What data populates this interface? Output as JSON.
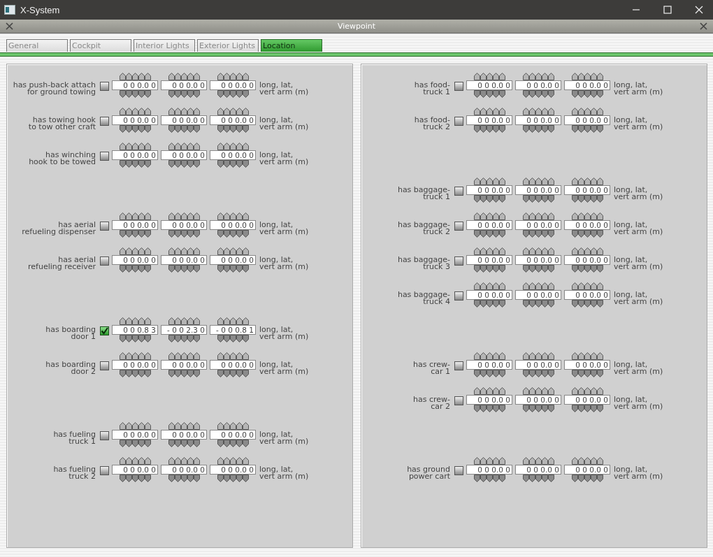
{
  "window": {
    "title": "X-System"
  },
  "dialog": {
    "title": "Viewpoint"
  },
  "tabs": [
    {
      "label": "General",
      "selected": false
    },
    {
      "label": "Cockpit",
      "selected": false
    },
    {
      "label": "Interior Lights",
      "selected": false
    },
    {
      "label": "Exterior Lights",
      "selected": false
    },
    {
      "label": "Location",
      "selected": true
    }
  ],
  "panels": [
    {
      "groups": [
        {
          "rows": [
            {
              "label": "has push-back attach\nfor ground towing",
              "checked": false,
              "values": [
                "0 0 0.0 0",
                "0 0 0.0 0",
                "0 0 0.0 0"
              ],
              "units": "long, lat,\nvert arm (m)"
            },
            {
              "label": "has towing hook\nto tow other craft",
              "checked": false,
              "values": [
                "0 0 0.0 0",
                "0 0 0.0 0",
                "0 0 0.0 0"
              ],
              "units": "long, lat,\nvert arm (m)"
            },
            {
              "label": "has winching\nhook to be towed",
              "checked": false,
              "values": [
                "0 0 0.0 0",
                "0 0 0.0 0",
                "0 0 0.0 0"
              ],
              "units": "long, lat,\nvert arm (m)"
            }
          ]
        },
        {
          "rows": [
            {
              "label": "has aerial\nrefueling dispenser",
              "checked": false,
              "values": [
                "0 0 0.0 0",
                "0 0 0.0 0",
                "0 0 0.0 0"
              ],
              "units": "long, lat,\nvert arm (m)"
            },
            {
              "label": "has aerial\nrefueling receiver",
              "checked": false,
              "values": [
                "0 0 0.0 0",
                "0 0 0.0 0",
                "0 0 0.0 0"
              ],
              "units": "long, lat,\nvert arm (m)"
            }
          ]
        },
        {
          "rows": [
            {
              "label": "has boarding\ndoor 1",
              "checked": true,
              "values": [
                "0 0 0.8 3",
                "- 0 0 2.3 0",
                "- 0 0 0.8 1"
              ],
              "units": "long, lat,\nvert arm (m)"
            },
            {
              "label": "has boarding\ndoor 2",
              "checked": false,
              "values": [
                "0 0 0.0 0",
                "0 0 0.0 0",
                "0 0 0.0 0"
              ],
              "units": "long, lat,\nvert arm (m)"
            }
          ]
        },
        {
          "rows": [
            {
              "label": "has fueling\ntruck 1",
              "checked": false,
              "values": [
                "0 0 0.0 0",
                "0 0 0.0 0",
                "0 0 0.0 0"
              ],
              "units": "long, lat,\nvert arm (m)"
            },
            {
              "label": "has fueling\ntruck 2",
              "checked": false,
              "values": [
                "0 0 0.0 0",
                "0 0 0.0 0",
                "0 0 0.0 0"
              ],
              "units": "long, lat,\nvert arm (m)"
            }
          ]
        }
      ]
    },
    {
      "groups": [
        {
          "rows": [
            {
              "label": "has food-\ntruck 1",
              "checked": false,
              "values": [
                "0 0 0.0 0",
                "0 0 0.0 0",
                "0 0 0.0 0"
              ],
              "units": "long, lat,\nvert arm (m)"
            },
            {
              "label": "has food-\ntruck 2",
              "checked": false,
              "values": [
                "0 0 0.0 0",
                "0 0 0.0 0",
                "0 0 0.0 0"
              ],
              "units": "long, lat,\nvert arm (m)"
            }
          ]
        },
        {
          "rows": [
            {
              "label": "has baggage-\ntruck 1",
              "checked": false,
              "values": [
                "0 0 0.0 0",
                "0 0 0.0 0",
                "0 0 0.0 0"
              ],
              "units": "long, lat,\nvert arm (m)"
            },
            {
              "label": "has baggage-\ntruck 2",
              "checked": false,
              "values": [
                "0 0 0.0 0",
                "0 0 0.0 0",
                "0 0 0.0 0"
              ],
              "units": "long, lat,\nvert arm (m)"
            },
            {
              "label": "has baggage-\ntruck 3",
              "checked": false,
              "values": [
                "0 0 0.0 0",
                "0 0 0.0 0",
                "0 0 0.0 0"
              ],
              "units": "long, lat,\nvert arm (m)"
            },
            {
              "label": "has baggage-\ntruck 4",
              "checked": false,
              "values": [
                "0 0 0.0 0",
                "0 0 0.0 0",
                "0 0 0.0 0"
              ],
              "units": "long, lat,\nvert arm (m)"
            }
          ]
        },
        {
          "rows": [
            {
              "label": "has crew-\ncar 1",
              "checked": false,
              "values": [
                "0 0 0.0 0",
                "0 0 0.0 0",
                "0 0 0.0 0"
              ],
              "units": "long, lat,\nvert arm (m)"
            },
            {
              "label": "has crew-\ncar 2",
              "checked": false,
              "values": [
                "0 0 0.0 0",
                "0 0 0.0 0",
                "0 0 0.0 0"
              ],
              "units": "long, lat,\nvert arm (m)"
            }
          ]
        },
        {
          "rows": [
            {
              "label": "has ground\npower cart",
              "checked": false,
              "values": [
                "0 0 0.0 0",
                "0 0 0.0 0",
                "0 0 0.0 0"
              ],
              "units": "long, lat,\nvert arm (m)"
            }
          ]
        }
      ]
    }
  ]
}
